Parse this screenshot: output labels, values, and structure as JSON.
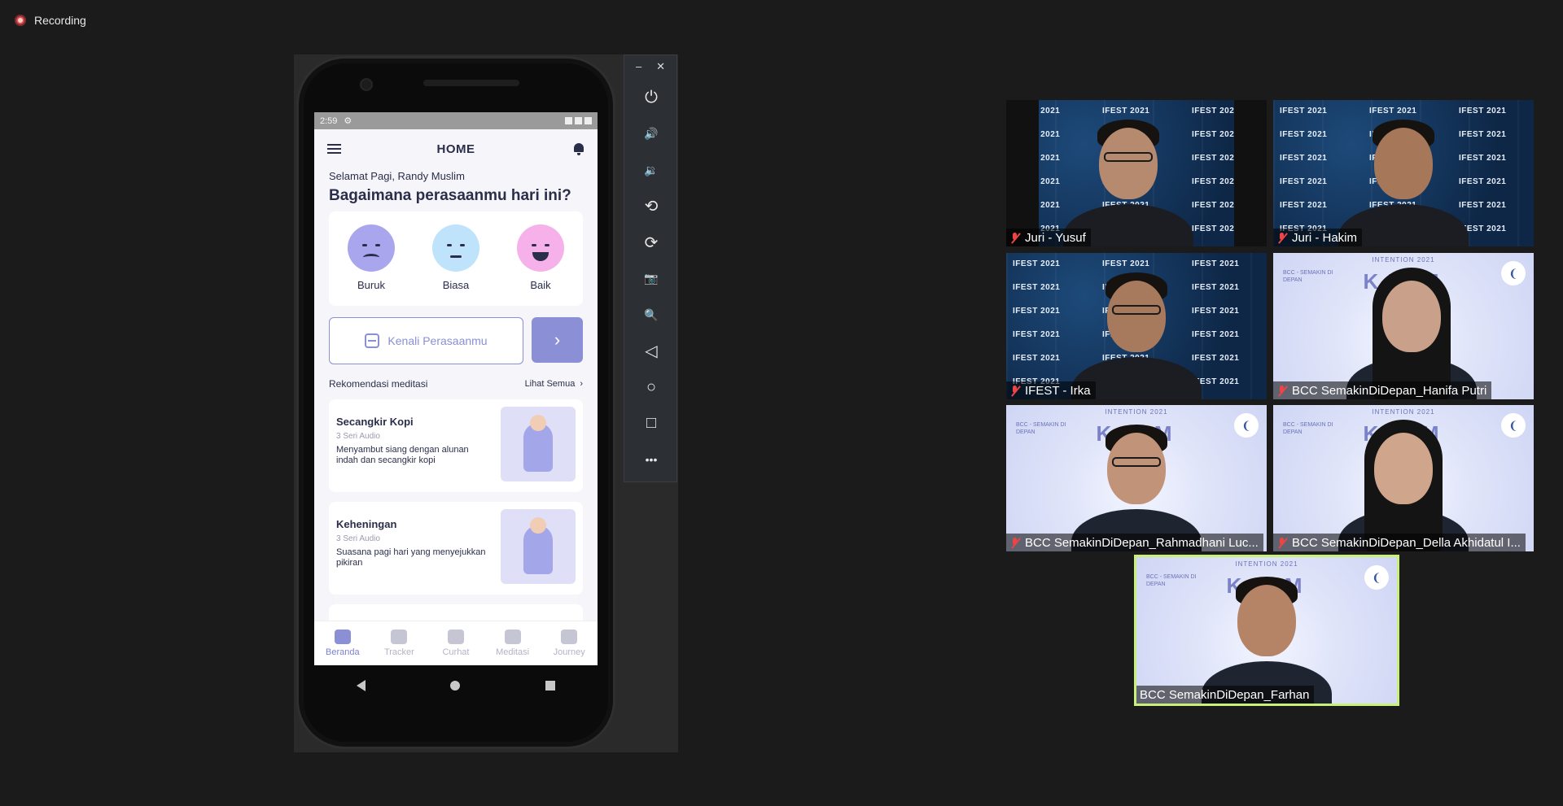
{
  "recording": {
    "label": "Recording"
  },
  "phone": {
    "status_time": "2:59",
    "app_title": "HOME",
    "greeting": "Selamat Pagi, Randy Muslim",
    "question": "Bagaimana perasaanmu hari ini?",
    "moods": [
      {
        "label": "Buruk",
        "icon": "sad-face-icon"
      },
      {
        "label": "Biasa",
        "icon": "neutral-face-icon"
      },
      {
        "label": "Baik",
        "icon": "happy-face-icon"
      }
    ],
    "kenali_button": "Kenali Perasaanmu",
    "next_button": "›",
    "recommend_title": "Rekomendasi meditasi",
    "see_all": "Lihat Semua",
    "see_all_arrow": "›",
    "cards": [
      {
        "title": "Secangkir Kopi",
        "sub": "3 Seri Audio",
        "desc": "Menyambut siang dengan alunan indah dan secangkir kopi"
      },
      {
        "title": "Keheningan",
        "sub": "3 Seri Audio",
        "desc": "Suasana pagi hari yang menyejukkan pikiran"
      }
    ],
    "nav": [
      {
        "label": "Beranda",
        "icon": "home-icon",
        "active": true
      },
      {
        "label": "Tracker",
        "icon": "pie-chart-icon",
        "active": false
      },
      {
        "label": "Curhat",
        "icon": "chat-icon",
        "active": false
      },
      {
        "label": "Meditasi",
        "icon": "music-icon",
        "active": false
      },
      {
        "label": "Journey",
        "icon": "flag-icon",
        "active": false
      }
    ],
    "accent_color": "#8a8fd6"
  },
  "emulator_toolbar": {
    "minimize": "–",
    "close": "✕",
    "buttons": [
      {
        "name": "power-icon",
        "glyph": "⏻"
      },
      {
        "name": "volume-up-icon",
        "glyph": "🔊"
      },
      {
        "name": "volume-down-icon",
        "glyph": "🔉"
      },
      {
        "name": "rotate-left-icon",
        "glyph": "⟲"
      },
      {
        "name": "rotate-right-icon",
        "glyph": "⟳"
      },
      {
        "name": "camera-icon",
        "glyph": "📷"
      },
      {
        "name": "zoom-icon",
        "glyph": "🔍"
      },
      {
        "name": "back-icon",
        "glyph": "◁"
      },
      {
        "name": "home-icon",
        "glyph": "○"
      },
      {
        "name": "overview-icon",
        "glyph": "□"
      },
      {
        "name": "more-icon",
        "glyph": "•••"
      }
    ]
  },
  "participants": [
    {
      "name": "Juri - Yusuf",
      "muted": true,
      "background": "ifest"
    },
    {
      "name": "Juri - Hakim",
      "muted": true,
      "background": "ifest"
    },
    {
      "name": "IFEST - Irka",
      "muted": true,
      "background": "ifest"
    },
    {
      "name": "BCC SemakinDiDepan_Hanifa Putri",
      "muted": true,
      "background": "kalm"
    },
    {
      "name": "BCC SemakinDiDepan_Rahmadhani Luc...",
      "muted": true,
      "background": "kalm"
    },
    {
      "name": "BCC SemakinDiDepan_Della Akhidatul I...",
      "muted": true,
      "background": "kalm"
    },
    {
      "name": "BCC SemakinDiDepan_Farhan",
      "muted": false,
      "background": "kalm",
      "active_speaker": true
    }
  ],
  "backgrounds": {
    "ifest_text": "IFEST 2021",
    "kalm_top": "INTENTION 2021",
    "kalm_big": "KALM",
    "kalm_small": "BCC - SEMAKIN DI DEPAN"
  }
}
